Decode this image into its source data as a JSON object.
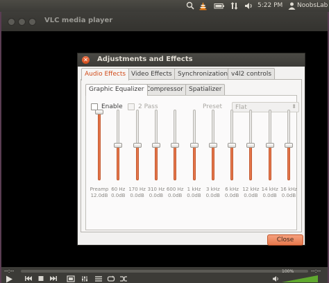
{
  "top_panel": {
    "time": "5:22 PM",
    "user": "NoobsLab",
    "icons": [
      "dropbox-icon",
      "vlc-cone-icon",
      "battery-icon",
      "network-icon",
      "volume-icon",
      "power-gear-icon"
    ]
  },
  "vlc": {
    "title": "VLC media player",
    "time_elapsed": "--:--",
    "time_total": "--:--",
    "volume": "100%",
    "volume_level": 1.0
  },
  "dialog": {
    "title": "Adjustments and Effects",
    "close_label": "Close",
    "tabs": [
      {
        "label": "Audio Effects",
        "active": true
      },
      {
        "label": "Video Effects",
        "active": false
      },
      {
        "label": "Synchronization",
        "active": false
      },
      {
        "label": "v4l2 controls",
        "active": false
      }
    ],
    "subtabs": [
      {
        "label": "Graphic Equalizer",
        "active": true
      },
      {
        "label": "Compressor",
        "active": false
      },
      {
        "label": "Spatializer",
        "active": false
      }
    ],
    "enable_label": "Enable",
    "two_pass_label": "2 Pass",
    "preset_label": "Preset",
    "preset_value": "Flat",
    "sliders": [
      {
        "band": "Preamp",
        "value": "12.0dB",
        "level": 1.0
      },
      {
        "band": "60 Hz",
        "value": "0.0dB",
        "level": 0.5
      },
      {
        "band": "170 Hz",
        "value": "0.0dB",
        "level": 0.5
      },
      {
        "band": "310 Hz",
        "value": "0.0dB",
        "level": 0.5
      },
      {
        "band": "600 Hz",
        "value": "0.0dB",
        "level": 0.5
      },
      {
        "band": "1 kHz",
        "value": "0.0dB",
        "level": 0.5
      },
      {
        "band": "3 kHz",
        "value": "0.0dB",
        "level": 0.5
      },
      {
        "band": "6 kHz",
        "value": "0.0dB",
        "level": 0.5
      },
      {
        "band": "12 kHz",
        "value": "0.0dB",
        "level": 0.5
      },
      {
        "band": "14 kHz",
        "value": "0.0dB",
        "level": 0.5
      },
      {
        "band": "16 kHz",
        "value": "0.0dB",
        "level": 0.5
      }
    ]
  },
  "colors": {
    "accent": "#d14b19",
    "slider_fill": "#e4764b",
    "panel_bg": "#3c3b37"
  }
}
